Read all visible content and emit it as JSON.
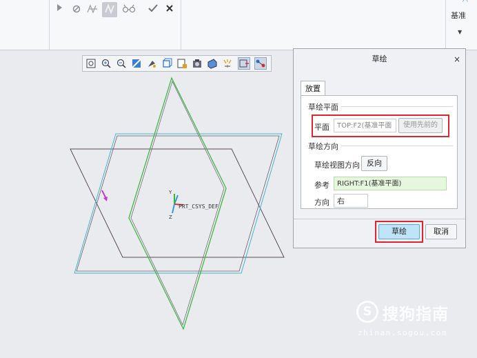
{
  "ribbon": {
    "icons": [
      "play-icon",
      "no-entry-icon",
      "node-icon",
      "layers-icon",
      "glasses-icon",
      "check-icon",
      "close-icon"
    ],
    "datum_label": "基准"
  },
  "canvas": {
    "csys_label": "PRT_CSYS_DEF",
    "axis_y": "Y",
    "axis_z": "Z",
    "colors": {
      "background": "#e9ebef",
      "dark_plane": "#5a4a5a",
      "cyan_plane": "#3fb7c9",
      "green_plane": "#3dbb3d",
      "accent_red": "#e0242c"
    }
  },
  "view_toolbar": {
    "icons": [
      "refit-icon",
      "zoom-in-icon",
      "zoom-out-icon",
      "repaint-icon",
      "display-style-icon",
      "saved-orientations-icon",
      "view-manager-icon",
      "perspective-icon",
      "datum-display-icon",
      "spin-center-icon",
      "annotation-display-icon",
      "sketch-view-icon"
    ]
  },
  "dialog": {
    "title": "草绘",
    "close": "×",
    "tab": "放置",
    "sketch_plane_group": "草绘平面",
    "plane_label": "平面",
    "plane_value": "TOP:F2(基准平面",
    "use_previous": "使用先前的",
    "orientation_group": "草绘方向",
    "view_direction_label": "草绘视图方向",
    "flip_button": "反向",
    "reference_label": "参考",
    "reference_value": "RIGHT:F1(基准平面)",
    "orientation_label": "方向",
    "orientation_value": "右",
    "sketch_button": "草绘",
    "cancel_button": "取消"
  },
  "watermark": {
    "logo": "S",
    "text": "搜狗指南",
    "url": "zhinan.sogou.com"
  }
}
